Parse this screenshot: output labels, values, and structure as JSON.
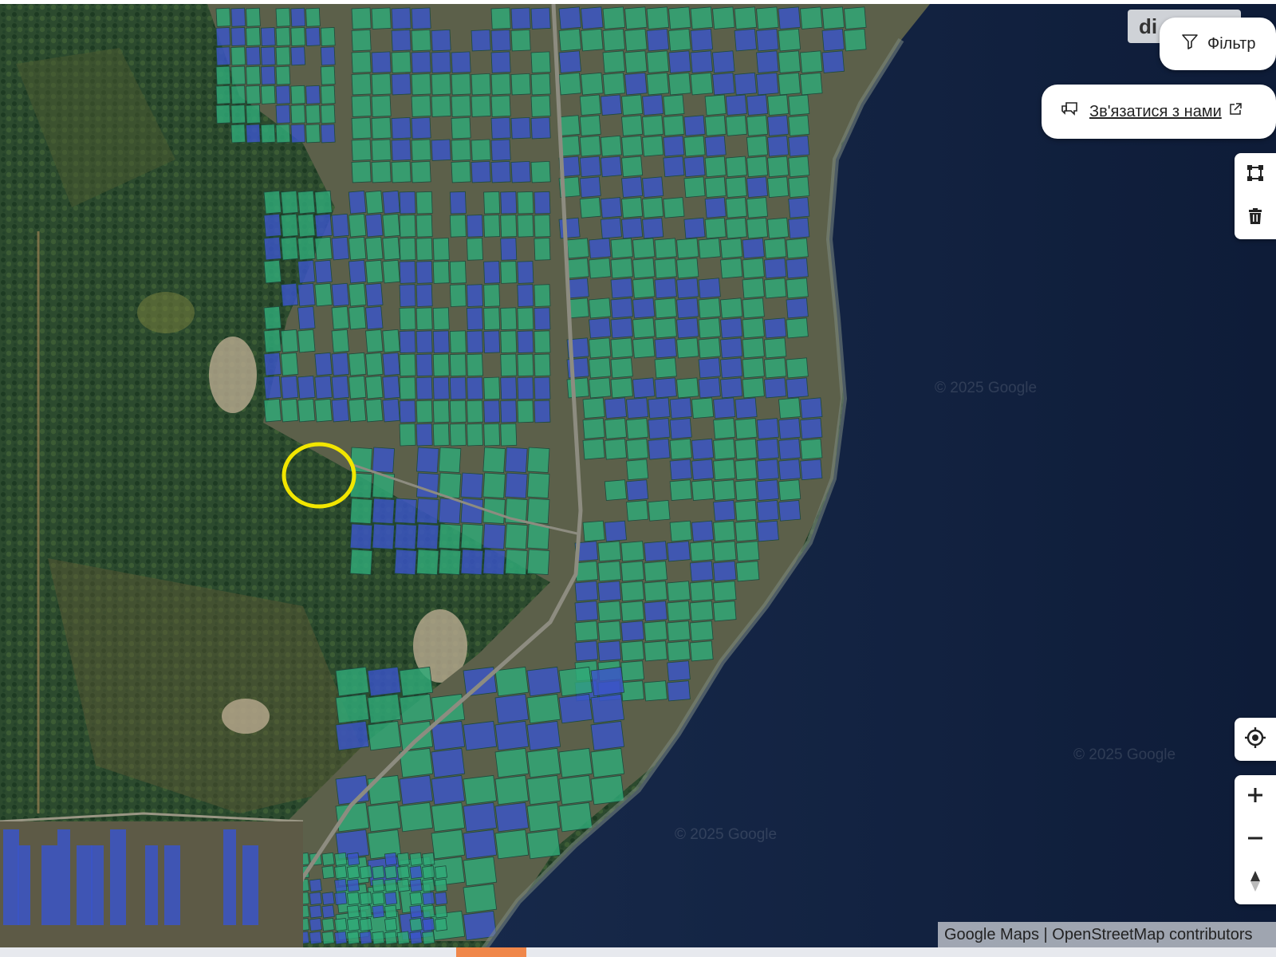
{
  "map": {
    "basemap": "satellite",
    "parcel_colors": {
      "green": "#2faa78",
      "blue": "#3a55c8"
    },
    "highlight": {
      "shape": "circle",
      "color": "#f2e600"
    },
    "watermarks": [
      "© 2025 Google",
      "© 2025 Google",
      "© 2025 Google"
    ],
    "attribution": "Google Maps | OpenStreetMap contributors"
  },
  "header": {
    "logo_text": "di",
    "filter_label": "Фільтр",
    "contact_label": "Зв'язатися з нами"
  },
  "icons": {
    "filter": "filter-icon",
    "chat": "chat-icon",
    "external": "external-link-icon",
    "draw_polygon": "draw-polygon-icon",
    "trash": "trash-icon",
    "locate": "locate-icon",
    "zoom_in": "plus-icon",
    "zoom_out": "minus-icon",
    "compass": "compass-icon"
  }
}
